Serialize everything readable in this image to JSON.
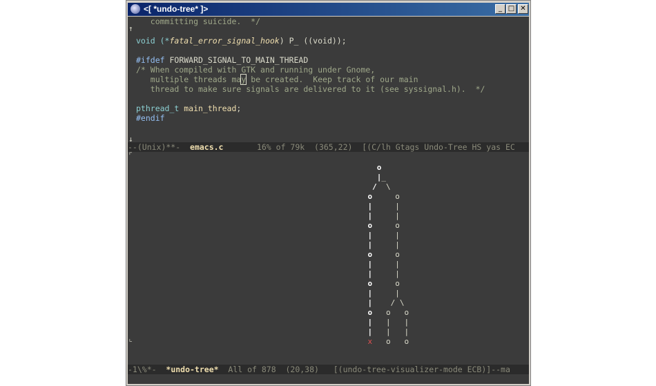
{
  "window": {
    "title": "<[ *undo-tree* ]>"
  },
  "buttons": {
    "minimize": "_",
    "maximize": "□",
    "close": "✕"
  },
  "code": {
    "l1": "   committing suicide.  */",
    "l2a": "void (*",
    "l2b": "fatal_error_signal_hook",
    "l2c": ") P_ ((void));",
    "l3a": "#ifdef",
    "l3b": " FORWARD_SIGNAL_TO_MAIN_THREAD",
    "l4": "/* When compiled with GTK and running under Gnome,",
    "l5a": "   multiple threads ma",
    "l5b": "y",
    "l5c": " be created.  Keep track of our main",
    "l6": "   thread to make sure signals are delivered to it (see syssignal.h).  */",
    "l7a": "pthread_t",
    "l7b": " main_thread",
    "l7c": ";",
    "l8": "#endif"
  },
  "modeline_top": {
    "prefix": "--(Unix)**-  ",
    "buffer": "emacs.c",
    "rest": "       16% of 79k  (365,22)  [(C/lh Gtags Undo-Tree HS yas EC"
  },
  "undo_tree": [
    "              o",
    "              |_",
    "             /  \\",
    "            o     o",
    "            |     |",
    "            |     |",
    "            o     o",
    "            |     |",
    "            |     |",
    "            o     o",
    "            |     |",
    "            |     |",
    "            o     o",
    "            |     |",
    "            |    / \\",
    "            o   o   o",
    "            |   |   |",
    "            |   |   |",
    "            x   o   o"
  ],
  "modeline_bottom": {
    "prefix": "-1\\%*-  ",
    "buffer": "*undo-tree*",
    "rest": "  All of 878  (20,38)   [(undo-tree-visualizer-mode ECB)]--ma"
  },
  "fringe": {
    "up": "↑",
    "down": "↓",
    "tl": "⌜",
    "bl": "⌞"
  }
}
